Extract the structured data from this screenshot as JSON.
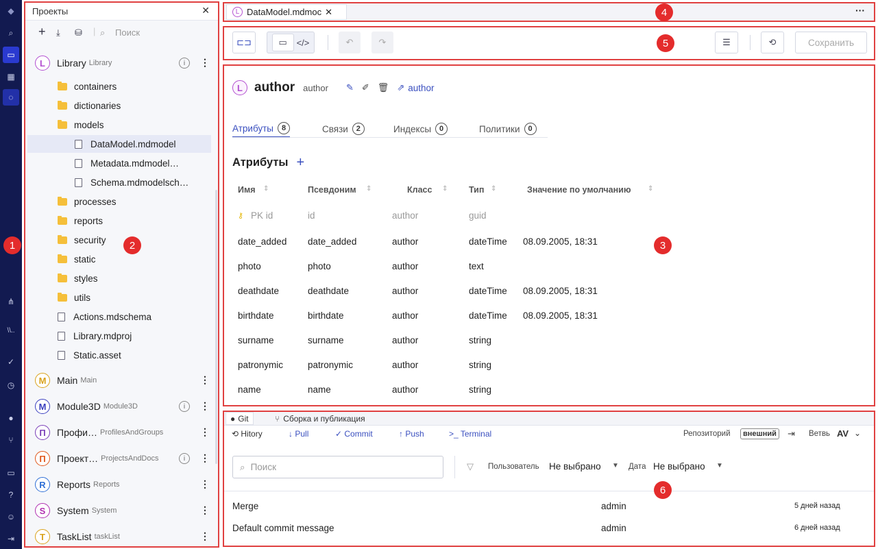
{
  "projects_panel": {
    "title": "Проекты",
    "search_placeholder": "Поиск",
    "tree": [
      {
        "kind": "project",
        "letter": "L",
        "name": "Library",
        "code": "Library",
        "color": "#b34fd1",
        "info": true
      },
      {
        "kind": "folder",
        "name": "containers"
      },
      {
        "kind": "folder",
        "name": "dictionaries"
      },
      {
        "kind": "folder",
        "name": "models"
      },
      {
        "kind": "file",
        "name": "DataModel.mdmodel",
        "selected": true
      },
      {
        "kind": "file",
        "name": "Metadata.mdmodel…"
      },
      {
        "kind": "file",
        "name": "Schema.mdmodelsch…"
      },
      {
        "kind": "folder",
        "name": "processes"
      },
      {
        "kind": "folder",
        "name": "reports"
      },
      {
        "kind": "folder",
        "name": "security"
      },
      {
        "kind": "folder",
        "name": "static"
      },
      {
        "kind": "folder",
        "name": "styles"
      },
      {
        "kind": "folder",
        "name": "utils"
      },
      {
        "kind": "file",
        "name": "Actions.mdschema"
      },
      {
        "kind": "file",
        "name": "Library.mdproj"
      },
      {
        "kind": "file",
        "name": "Static.asset"
      },
      {
        "kind": "project",
        "letter": "M",
        "name": "Main",
        "code": "Main",
        "color": "#d9a21a",
        "info": false
      },
      {
        "kind": "project",
        "letter": "M",
        "name": "Module3D",
        "code": "Module3D",
        "color": "#3a3fbf",
        "info": true
      },
      {
        "kind": "project",
        "letter": "П",
        "name": "Профи…",
        "code": "ProfilesAndGroups",
        "color": "#7a3fb8",
        "info": false
      },
      {
        "kind": "project",
        "letter": "П",
        "name": "Проект…",
        "code": "ProjectsAndDocs",
        "color": "#e0561a",
        "info": true
      },
      {
        "kind": "project",
        "letter": "R",
        "name": "Reports",
        "code": "Reports",
        "color": "#2f6fd6",
        "info": false
      },
      {
        "kind": "project",
        "letter": "S",
        "name": "System",
        "code": "System",
        "color": "#b02fb0",
        "info": false
      },
      {
        "kind": "project",
        "letter": "T",
        "name": "TaskList",
        "code": "taskList",
        "color": "#d9a21a",
        "info": false
      }
    ]
  },
  "file_tab": {
    "letter": "L",
    "name": "DataModel.mdmoc"
  },
  "toolbar": {
    "save_label": "Сохранить"
  },
  "entity": {
    "letter": "L",
    "name": "author",
    "code": "author",
    "link_label": "author",
    "tabs": [
      {
        "label": "Атрибуты",
        "count": "8",
        "active": true
      },
      {
        "label": "Связи",
        "count": "2",
        "active": false
      },
      {
        "label": "Индексы",
        "count": "0",
        "active": false
      },
      {
        "label": "Политики",
        "count": "0",
        "active": false
      }
    ],
    "section_title": "Атрибуты",
    "columns": [
      "Имя",
      "Псевдоним",
      "Класс",
      "Тип",
      "Значение по умолчанию"
    ],
    "rows": [
      {
        "name": "PK id",
        "alias": "id",
        "class": "author",
        "type": "guid",
        "default": "",
        "pk": true
      },
      {
        "name": "date_added",
        "alias": "date_added",
        "class": "author",
        "type": "dateTime",
        "default": "08.09.2005, 18:31"
      },
      {
        "name": "photo",
        "alias": "photo",
        "class": "author",
        "type": "text",
        "default": ""
      },
      {
        "name": "deathdate",
        "alias": "deathdate",
        "class": "author",
        "type": "dateTime",
        "default": "08.09.2005, 18:31"
      },
      {
        "name": "birthdate",
        "alias": "birthdate",
        "class": "author",
        "type": "dateTime",
        "default": "08.09.2005, 18:31"
      },
      {
        "name": "surname",
        "alias": "surname",
        "class": "author",
        "type": "string",
        "default": ""
      },
      {
        "name": "patronymic",
        "alias": "patronymic",
        "class": "author",
        "type": "string",
        "default": ""
      },
      {
        "name": "name",
        "alias": "name",
        "class": "author",
        "type": "string",
        "default": ""
      }
    ]
  },
  "git_panel": {
    "tabs": [
      "Git",
      "Сборка и публикация"
    ],
    "actions": [
      "Hitory",
      "Pull",
      "Commit",
      "Push",
      "Terminal"
    ],
    "repo_label": "Репозиторий",
    "repo_value": "внешний",
    "branch_label": "Ветвь",
    "branch_value": "AV",
    "search_placeholder": "Поиск",
    "user_label": "Пользователь",
    "user_value": "Не выбрано",
    "date_label": "Дата",
    "date_value": "Не выбрано",
    "commits": [
      {
        "message": "Merge",
        "author": "admin",
        "when": "5 дней назад"
      },
      {
        "message": "Default commit message",
        "author": "admin",
        "when": "6 дней назад"
      }
    ]
  },
  "markers": [
    "1",
    "2",
    "3",
    "4",
    "5",
    "6"
  ],
  "colors": {
    "rail": "#121a50",
    "accent": "#3a4fbf",
    "marker": "#e42c2c",
    "highlight_box": "#e04040"
  }
}
